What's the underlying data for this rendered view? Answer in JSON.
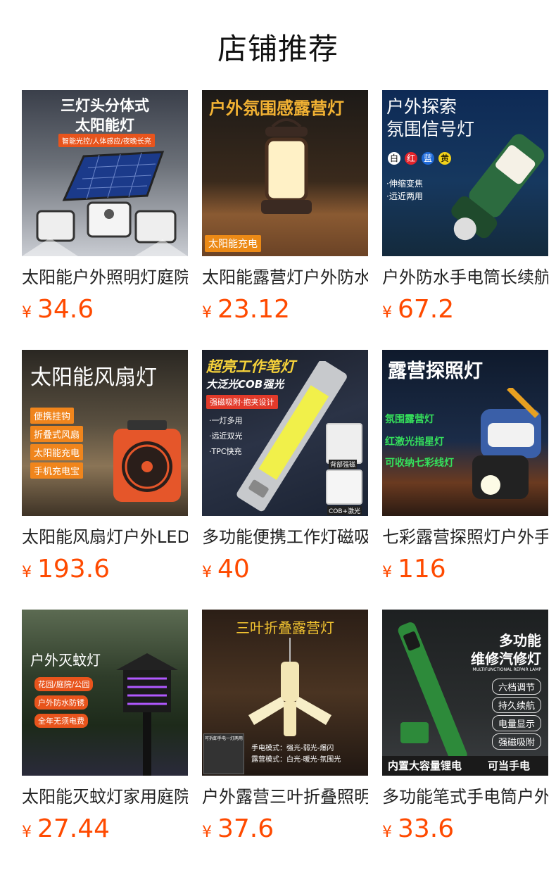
{
  "page": {
    "title": "店铺推荐"
  },
  "currency": "¥",
  "products": [
    {
      "name": "太阳能户外照明灯庭院",
      "price": "34.6",
      "image_text": {
        "head1": "三灯头分体式",
        "head2": "太阳能灯",
        "strip": "智能光控/人体感应/夜晚长亮"
      }
    },
    {
      "name": "太阳能露营灯户外防水",
      "price": "23.12",
      "image_text": {
        "head1": "户外氛围感露营灯",
        "badge": "太阳能充电"
      }
    },
    {
      "name": "户外防水手电筒长续航",
      "price": "67.2",
      "image_text": {
        "head1": "户外探索",
        "head2": "氛围信号灯",
        "c1": "白",
        "c2": "红",
        "c3": "蓝",
        "c4": "黄",
        "b1": "·伸缩变焦",
        "b2": "·远近两用"
      }
    },
    {
      "name": "太阳能风扇灯户外LED",
      "price": "193.6",
      "image_text": {
        "head1": "太阳能风扇灯",
        "t1": "便携挂钩",
        "t2": "折叠式风扇",
        "t3": "太阳能充电",
        "t4": "手机充电宝"
      }
    },
    {
      "name": "多功能便携工作灯磁吸",
      "price": "40",
      "image_text": {
        "head1": "超亮工作笔灯",
        "head2": "大泛光COB强光",
        "strip": "强磁吸附·抱夹设计",
        "b1": "·一灯多用",
        "b2": "·远近双光",
        "b3": "·TPC快充",
        "l1": "背部强磁",
        "l2": "COB+激光"
      }
    },
    {
      "name": "七彩露营探照灯户外手",
      "price": "116",
      "image_text": {
        "head1": "露营探照灯",
        "g1": "氛围露营灯",
        "g2": "红激光指星灯",
        "g3": "可收纳七彩线灯"
      }
    },
    {
      "name": "太阳能灭蚊灯家用庭院",
      "price": "27.44",
      "image_text": {
        "head1": "户外灭蚊灯",
        "t1": "花园/庭院/公园",
        "t2": "户外防水防锈",
        "t3": "全年无须电费"
      }
    },
    {
      "name": "户外露营三叶折叠照明",
      "price": "37.6",
      "image_text": {
        "head1": "三叶折叠露营灯",
        "m1": "手电模式：强光-弱光-爆闪",
        "m2": "露营模式：白光-暖光-氛围光",
        "mini": "可拆卸手电一灯两用"
      }
    },
    {
      "name": "多功能笔式手电筒户外",
      "price": "33.6",
      "image_text": {
        "head1": "多功能",
        "head2": "维修汽修灯",
        "sub": "MULTIFUNCTIONAL REPAIR LAMP",
        "p1": "六档调节",
        "p2": "持久续航",
        "p3": "电量显示",
        "p4": "强磁吸附",
        "f1": "内置大容量锂电",
        "f2": "可当手电"
      }
    }
  ]
}
